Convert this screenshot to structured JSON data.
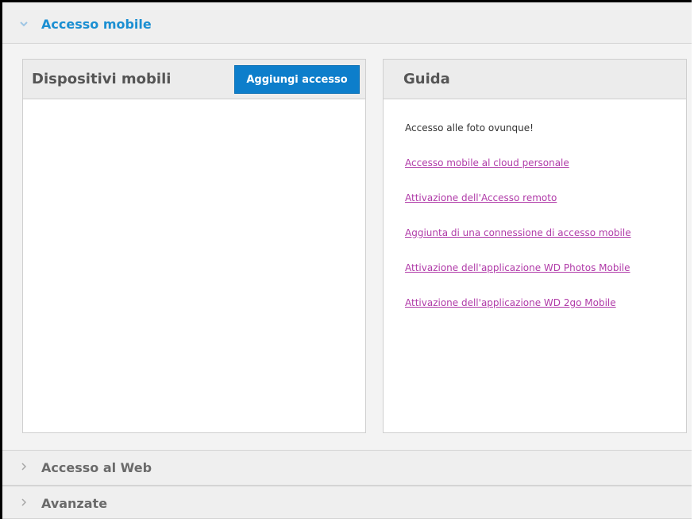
{
  "sections": {
    "mobile_access": {
      "title": "Accesso mobile",
      "expanded": true
    },
    "web_access": {
      "title": "Accesso al Web",
      "expanded": false
    },
    "advanced": {
      "title": "Avanzate",
      "expanded": false
    }
  },
  "devices_panel": {
    "title": "Dispositivi mobili",
    "add_button_label": "Aggiungi accesso"
  },
  "help_panel": {
    "title": "Guida",
    "intro": "Accesso alle foto ovunque!",
    "links": [
      "Accesso mobile al cloud personale",
      "Attivazione dell'Accesso remoto",
      "Aggiunta di una connessione di accesso mobile",
      "Attivazione dell'applicazione WD Photos Mobile",
      "Attivazione dell'applicazione WD 2go Mobile"
    ]
  },
  "colors": {
    "accent": "#1b8fd2",
    "button": "#0d7ecb",
    "link": "#b03aa8"
  }
}
